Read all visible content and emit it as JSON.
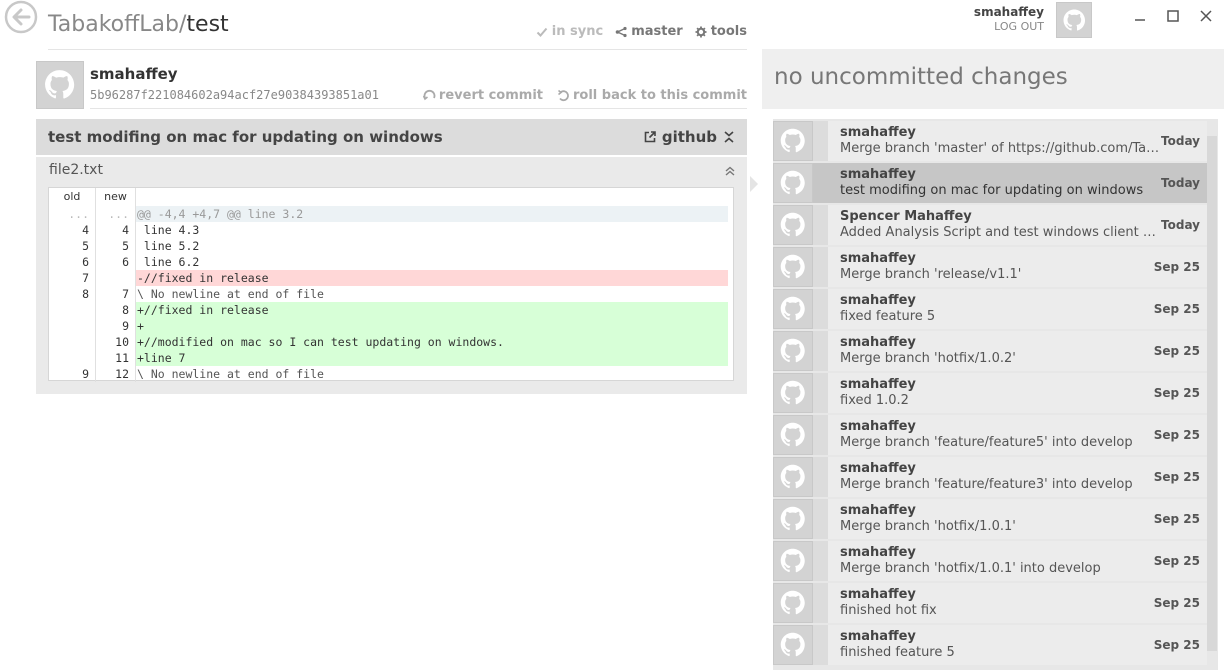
{
  "repo": {
    "owner": "TabakoffLab/",
    "name": "test"
  },
  "top_actions": {
    "sync": "in sync",
    "branch": "master",
    "tools": "tools"
  },
  "commit": {
    "author": "smahaffey",
    "sha": "5b96287f221084602a94acf27e90384393851a01",
    "revert_label": "revert commit",
    "rollback_label": "roll back to this commit",
    "message": "test modifing on mac for updating on windows",
    "github_label": "github"
  },
  "file": {
    "name": "file2.txt",
    "col_old": "old",
    "col_new": "new",
    "lines": [
      {
        "kind": "hunk",
        "old": "...",
        "new": "...",
        "text": "@@ -4,4 +4,7 @@ line 3.2"
      },
      {
        "kind": "ctx",
        "old": "4",
        "new": "4",
        "text": " line 4.3"
      },
      {
        "kind": "ctx",
        "old": "5",
        "new": "5",
        "text": " line 5.2"
      },
      {
        "kind": "ctx",
        "old": "6",
        "new": "6",
        "text": " line 6.2"
      },
      {
        "kind": "del",
        "old": "7",
        "new": "",
        "text": "-//fixed in release"
      },
      {
        "kind": "info",
        "old": "8",
        "new": "7",
        "text": "\\ No newline at end of file"
      },
      {
        "kind": "add",
        "old": "",
        "new": "8",
        "text": "+//fixed in release"
      },
      {
        "kind": "add",
        "old": "",
        "new": "9",
        "text": "+"
      },
      {
        "kind": "add",
        "old": "",
        "new": "10",
        "text": "+//modified on mac so I can test updating on windows."
      },
      {
        "kind": "add",
        "old": "",
        "new": "11",
        "text": "+line 7"
      },
      {
        "kind": "info",
        "old": "9",
        "new": "12",
        "text": "\\ No newline at end of file"
      }
    ]
  },
  "user": {
    "name": "smahaffey",
    "logout": "LOG OUT"
  },
  "changes": {
    "text": "no uncommitted changes"
  },
  "history": [
    {
      "author": "smahaffey",
      "message": "Merge branch 'master' of https://github.com/TabakoffLab/test",
      "date": "Today",
      "selected": false
    },
    {
      "author": "smahaffey",
      "message": "test modifing on mac for updating on windows",
      "date": "Today",
      "selected": true
    },
    {
      "author": "Spencer Mahaffey",
      "message": "Added Analysis Script and test windows client file",
      "date": "Today",
      "selected": false
    },
    {
      "author": "smahaffey",
      "message": "Merge branch 'release/v1.1'",
      "date": "Sep 25",
      "selected": false
    },
    {
      "author": "smahaffey",
      "message": "fixed feature 5",
      "date": "Sep 25",
      "selected": false
    },
    {
      "author": "smahaffey",
      "message": "Merge branch 'hotfix/1.0.2'",
      "date": "Sep 25",
      "selected": false
    },
    {
      "author": "smahaffey",
      "message": "fixed 1.0.2",
      "date": "Sep 25",
      "selected": false
    },
    {
      "author": "smahaffey",
      "message": "Merge branch 'feature/feature5' into develop",
      "date": "Sep 25",
      "selected": false
    },
    {
      "author": "smahaffey",
      "message": "Merge branch 'feature/feature3' into develop",
      "date": "Sep 25",
      "selected": false
    },
    {
      "author": "smahaffey",
      "message": "Merge branch 'hotfix/1.0.1'",
      "date": "Sep 25",
      "selected": false
    },
    {
      "author": "smahaffey",
      "message": "Merge branch 'hotfix/1.0.1' into develop",
      "date": "Sep 25",
      "selected": false
    },
    {
      "author": "smahaffey",
      "message": "finished hot fix",
      "date": "Sep 25",
      "selected": false
    },
    {
      "author": "smahaffey",
      "message": "finished feature 5",
      "date": "Sep 25",
      "selected": false
    }
  ],
  "colors": {
    "panel": "#dcdcdc",
    "selected": "#c6c6c6",
    "added": "#d7ffd7",
    "removed": "#ffd7d7"
  }
}
